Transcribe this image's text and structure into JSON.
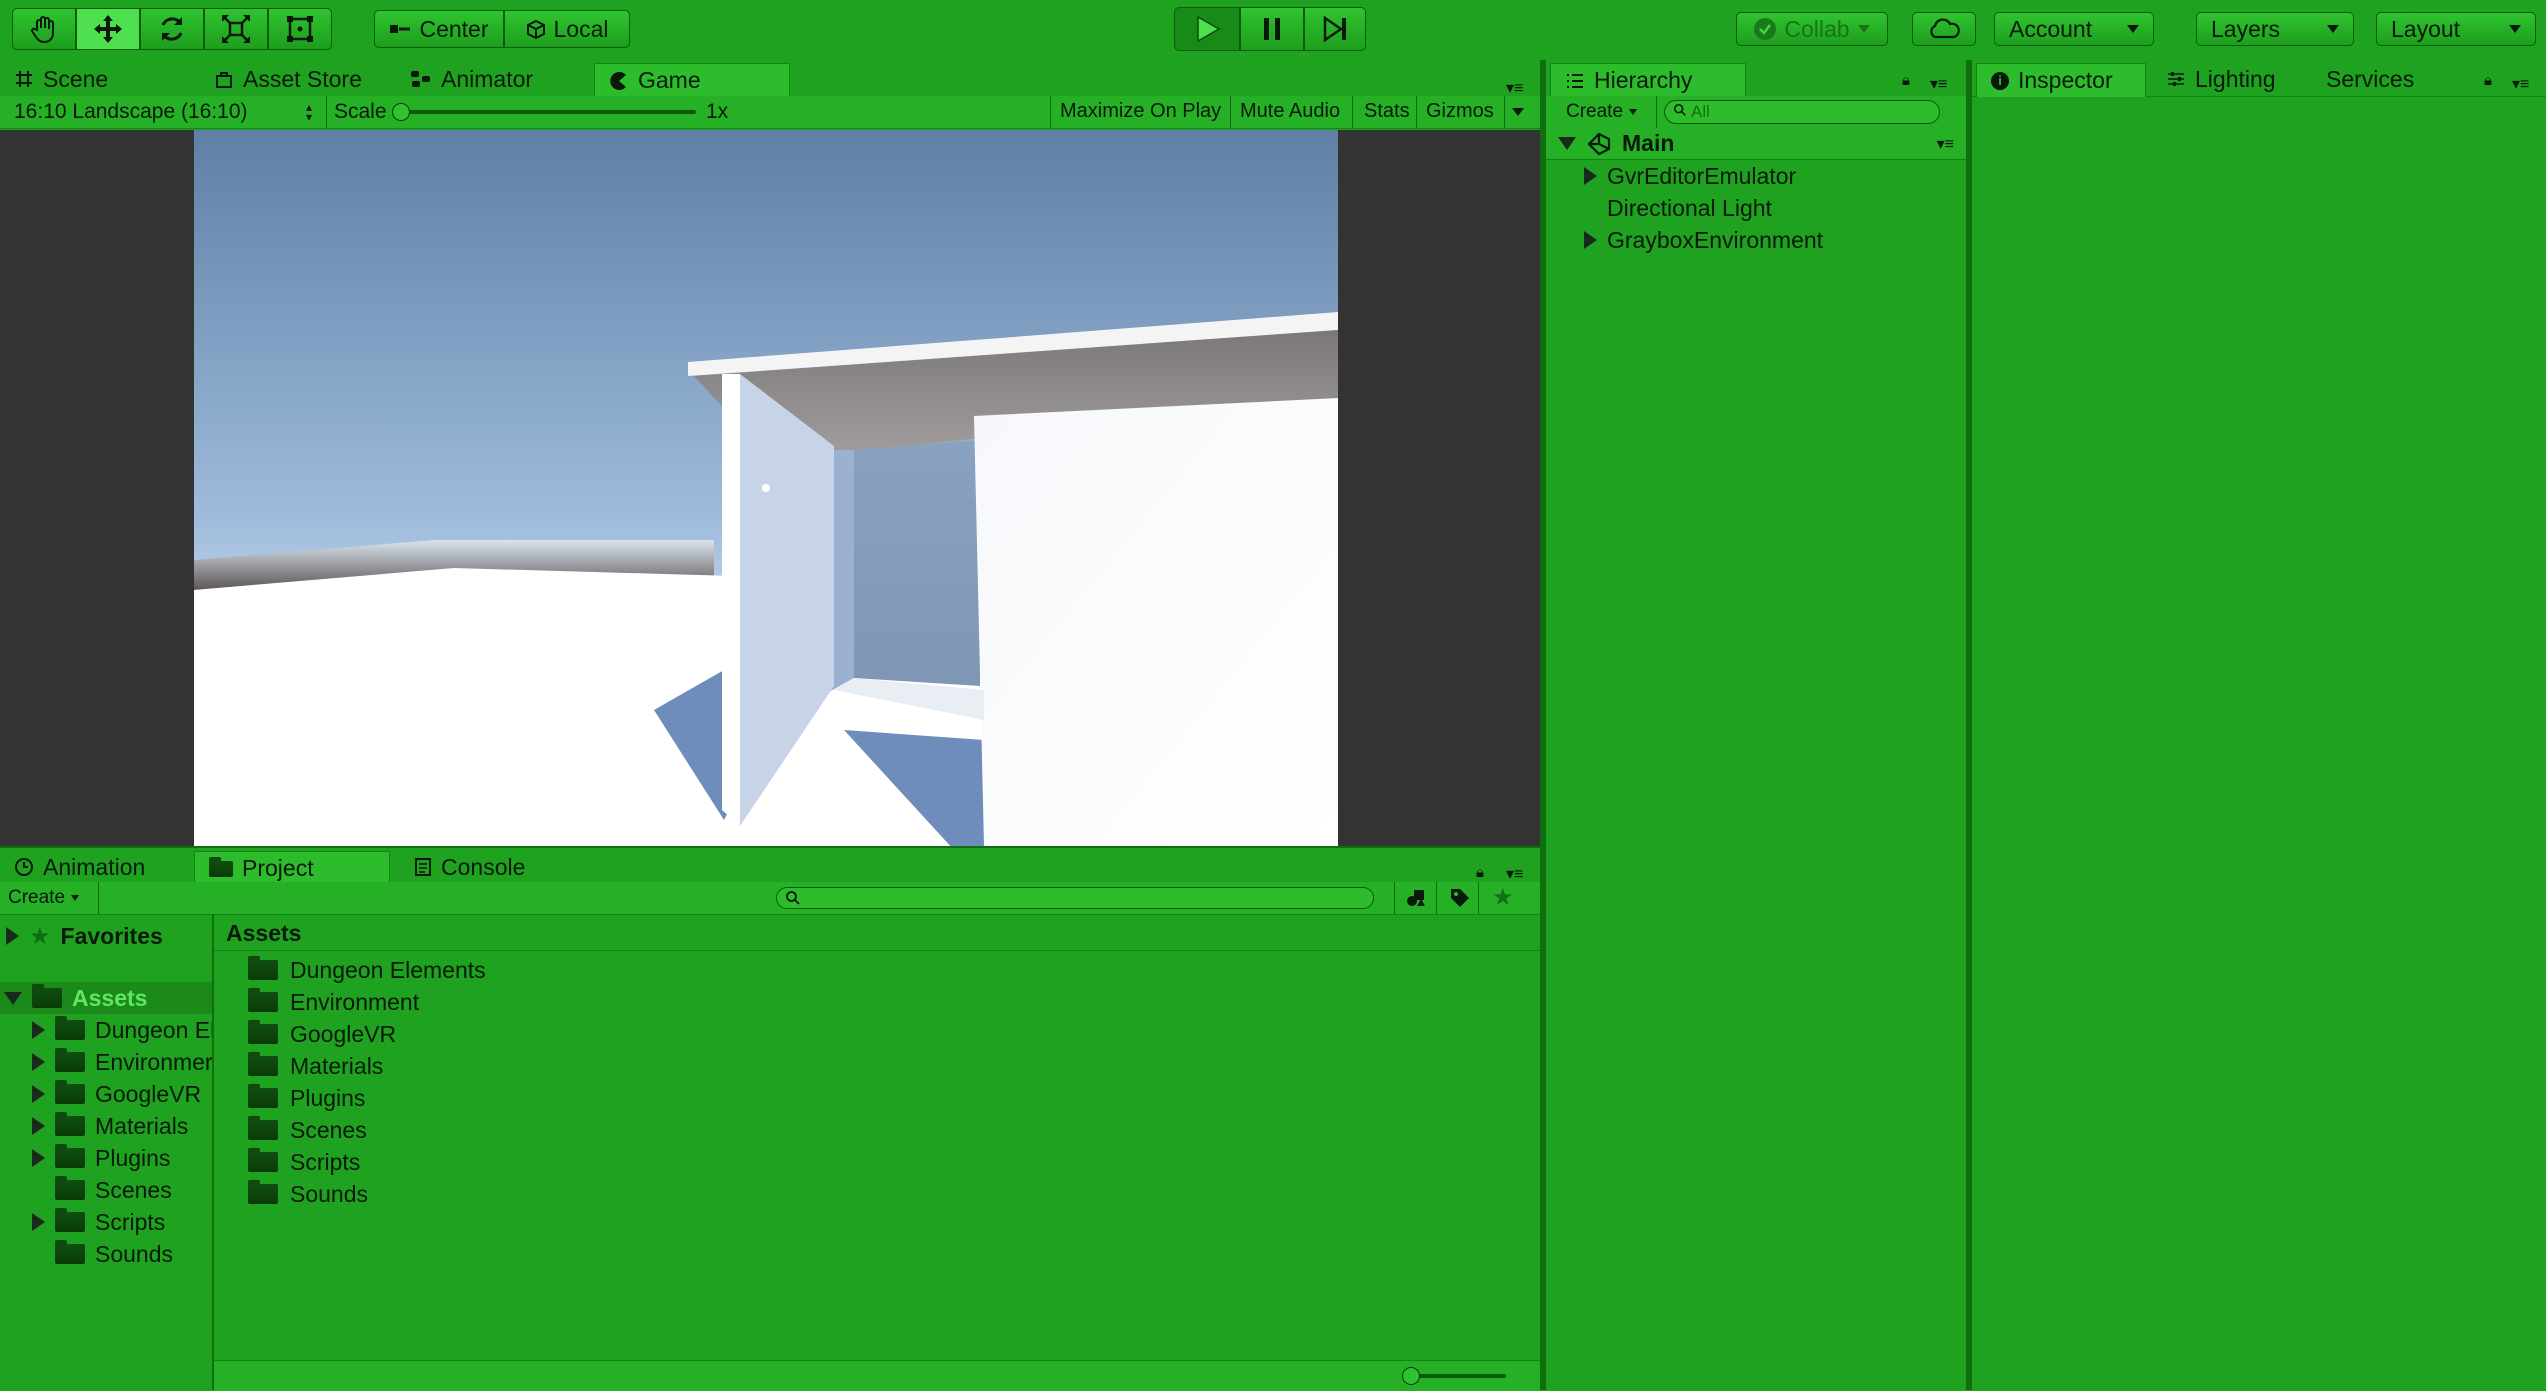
{
  "toolbar": {
    "tools": [
      {
        "name": "hand-tool",
        "icon": "hand-icon"
      },
      {
        "name": "move-tool",
        "icon": "move-icon"
      },
      {
        "name": "rotate-tool",
        "icon": "rotate-icon"
      },
      {
        "name": "scale-tool",
        "icon": "scale-icon"
      },
      {
        "name": "rect-tool",
        "icon": "rect-icon"
      }
    ],
    "pivot_label": "Center",
    "space_label": "Local",
    "collab_label": "Collab",
    "account_label": "Account",
    "layers_label": "Layers",
    "layout_label": "Layout"
  },
  "game_panel": {
    "tabs": [
      "Scene",
      "Asset Store",
      "Animator",
      "Game"
    ],
    "active_tab": "Game",
    "aspect": "16:10 Landscape (16:10)",
    "scale_label": "Scale",
    "scale_value": "1x",
    "maximize_label": "Maximize On Play",
    "mute_label": "Mute Audio",
    "stats_label": "Stats",
    "gizmos_label": "Gizmos"
  },
  "hierarchy": {
    "tab": "Hierarchy",
    "create_label": "Create",
    "search_placeholder": "All",
    "scene_name": "Main",
    "items": [
      {
        "label": "GvrEditorEmulator",
        "expandable": true
      },
      {
        "label": "Directional Light",
        "expandable": false
      },
      {
        "label": "GrayboxEnvironment",
        "expandable": true
      }
    ]
  },
  "inspector": {
    "tabs": [
      "Inspector",
      "Lighting",
      "Services"
    ]
  },
  "project": {
    "tabs": [
      "Animation",
      "Project",
      "Console"
    ],
    "create_label": "Create",
    "favorites_label": "Favorites",
    "assets_label": "Assets",
    "breadcrumb": "Assets",
    "tree": [
      {
        "label": "Dungeon El",
        "expandable": true
      },
      {
        "label": "Environmer",
        "expandable": true
      },
      {
        "label": "GoogleVR",
        "expandable": true
      },
      {
        "label": "Materials",
        "expandable": true
      },
      {
        "label": "Plugins",
        "expandable": true
      },
      {
        "label": "Scenes",
        "expandable": false
      },
      {
        "label": "Scripts",
        "expandable": true
      },
      {
        "label": "Sounds",
        "expandable": false
      }
    ],
    "folders": [
      "Dungeon Elements",
      "Environment",
      "GoogleVR",
      "Materials",
      "Plugins",
      "Scenes",
      "Scripts",
      "Sounds"
    ]
  },
  "colors": {
    "background": "#1fa21f",
    "dark_viewport": "#333333",
    "sky_top": "#5f7fa5",
    "ground": "#ffffff"
  }
}
